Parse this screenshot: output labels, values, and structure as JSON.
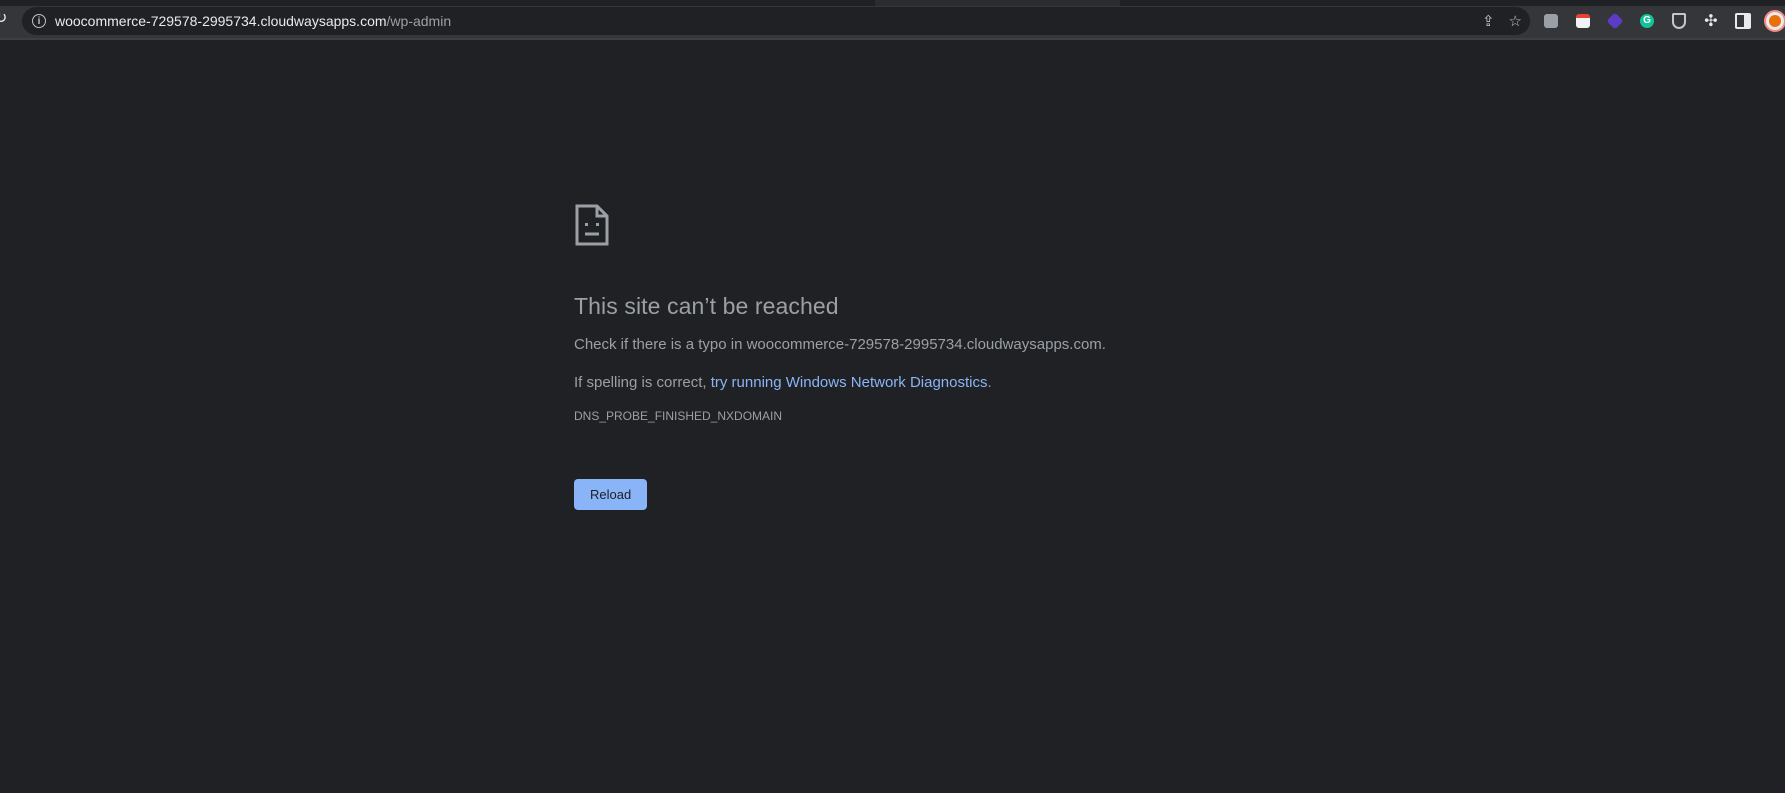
{
  "browser": {
    "url_host": "woocommerce-729578-2995734.cloudwaysapps.com",
    "url_path": "/wp-admin",
    "icons": {
      "site_info": "info-icon",
      "share": "share-icon",
      "bookmark": "star-icon",
      "reload": "reload-icon"
    },
    "extensions": [
      "camera-icon",
      "calendar-icon",
      "layers-icon",
      "grammarly-icon",
      "shield-icon",
      "puzzle-icon",
      "side-panel-icon",
      "profile-avatar"
    ]
  },
  "error_page": {
    "title": "This site can’t be reached",
    "typo_prefix": "Check if there is a typo in ",
    "typo_host": "woocommerce-729578-2995734.cloudwaysapps.com",
    "typo_suffix": ".",
    "spelling_prefix": "If spelling is correct, ",
    "diagnostics_link": "try running Windows Network Diagnostics",
    "spelling_suffix": ".",
    "error_code": "DNS_PROBE_FINISHED_NXDOMAIN",
    "reload_label": "Reload"
  },
  "colors": {
    "background": "#202124",
    "text_muted": "#9aa0a6",
    "link": "#8ab4f8",
    "button": "#8ab4f8"
  }
}
